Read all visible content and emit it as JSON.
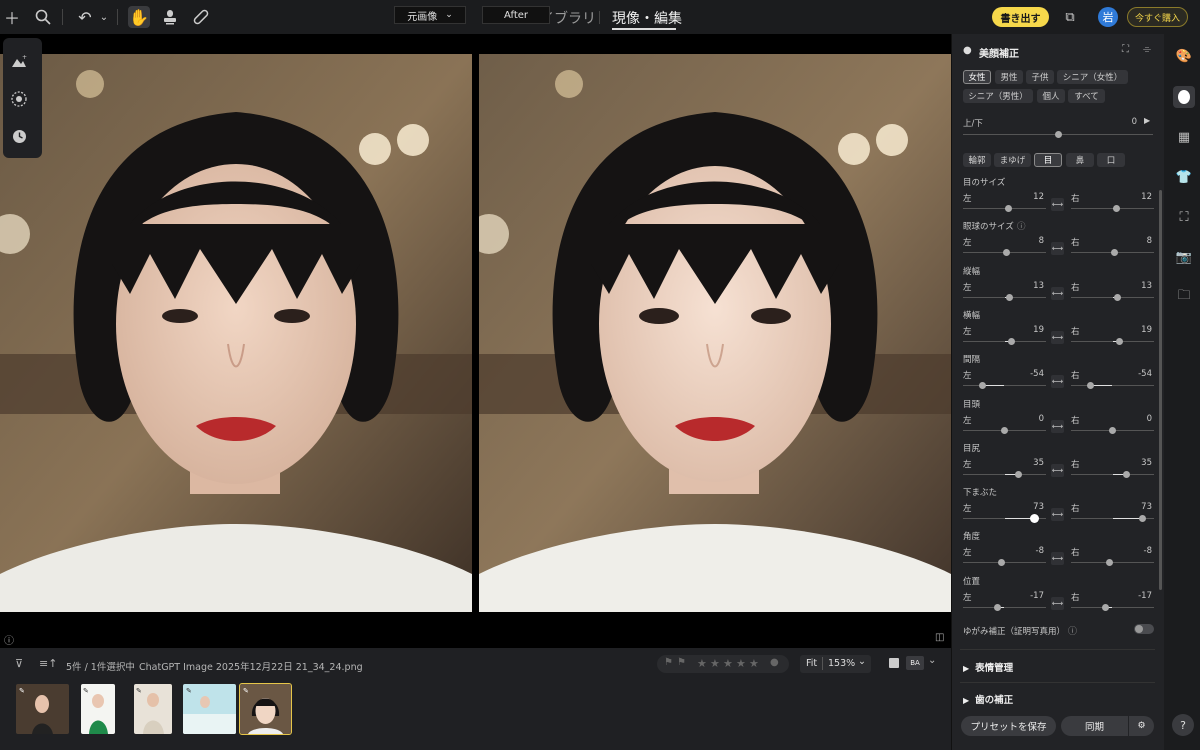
{
  "topbar": {
    "tabs": [
      {
        "label": "ライブラリ"
      },
      {
        "label": "現像・編集"
      }
    ],
    "export_label": "書き出す",
    "avatar_initial": "岩",
    "buy_label": "今すぐ購入"
  },
  "viewer": {
    "before_label": "元画像",
    "after_label": "After"
  },
  "filmstrip": {
    "count_text": "5件 / 1件選択中",
    "filename": "ChatGPT Image 2025年12月22日 21_34_24.png",
    "fit_label": "Fit",
    "zoom_label": "153%",
    "thumbnails": [
      {
        "name": "thumb-1"
      },
      {
        "name": "thumb-2"
      },
      {
        "name": "thumb-3"
      },
      {
        "name": "thumb-4"
      },
      {
        "name": "thumb-5"
      }
    ],
    "rating_stars": 0
  },
  "panel": {
    "title": "美顔補正",
    "face_filters": [
      "女性",
      "男性",
      "子供",
      "シニア（女性）",
      "シニア（男性）",
      "個人",
      "すべて"
    ],
    "selected_filter": "女性",
    "updown_label": "上/下",
    "updown_value": "0",
    "updown_pos": 0.5,
    "feature_tabs": [
      "輪郭",
      "まゆげ",
      "目",
      "鼻",
      "口"
    ],
    "selected_feature": "目",
    "left_label": "左",
    "right_label": "右",
    "sliders": [
      {
        "label": "目のサイズ",
        "left": "12",
        "right": "12",
        "pos": 0.55,
        "help": false
      },
      {
        "label": "眼球のサイズ",
        "left": "8",
        "right": "8",
        "pos": 0.53,
        "help": true
      },
      {
        "label": "縦幅",
        "left": "13",
        "right": "13",
        "pos": 0.56,
        "help": false
      },
      {
        "label": "横幅",
        "left": "19",
        "right": "19",
        "pos": 0.59,
        "help": false
      },
      {
        "label": "間隔",
        "left": "-54",
        "right": "-54",
        "pos": 0.23,
        "help": false
      },
      {
        "label": "目頭",
        "left": "0",
        "right": "0",
        "pos": 0.5,
        "help": false
      },
      {
        "label": "目尻",
        "left": "35",
        "right": "35",
        "pos": 0.67,
        "help": false
      },
      {
        "label": "下まぶた",
        "left": "73",
        "right": "73",
        "pos": 0.86,
        "help": false
      },
      {
        "label": "角度",
        "left": "-8",
        "right": "-8",
        "pos": 0.46,
        "help": false
      },
      {
        "label": "位置",
        "left": "-17",
        "right": "-17",
        "pos": 0.41,
        "help": false
      }
    ],
    "distortion_label": "ゆがみ補正（証明写真用）",
    "sections": [
      "表情管理",
      "歯の補正"
    ],
    "save_preset_label": "プリセットを保存",
    "sync_label": "同期"
  }
}
